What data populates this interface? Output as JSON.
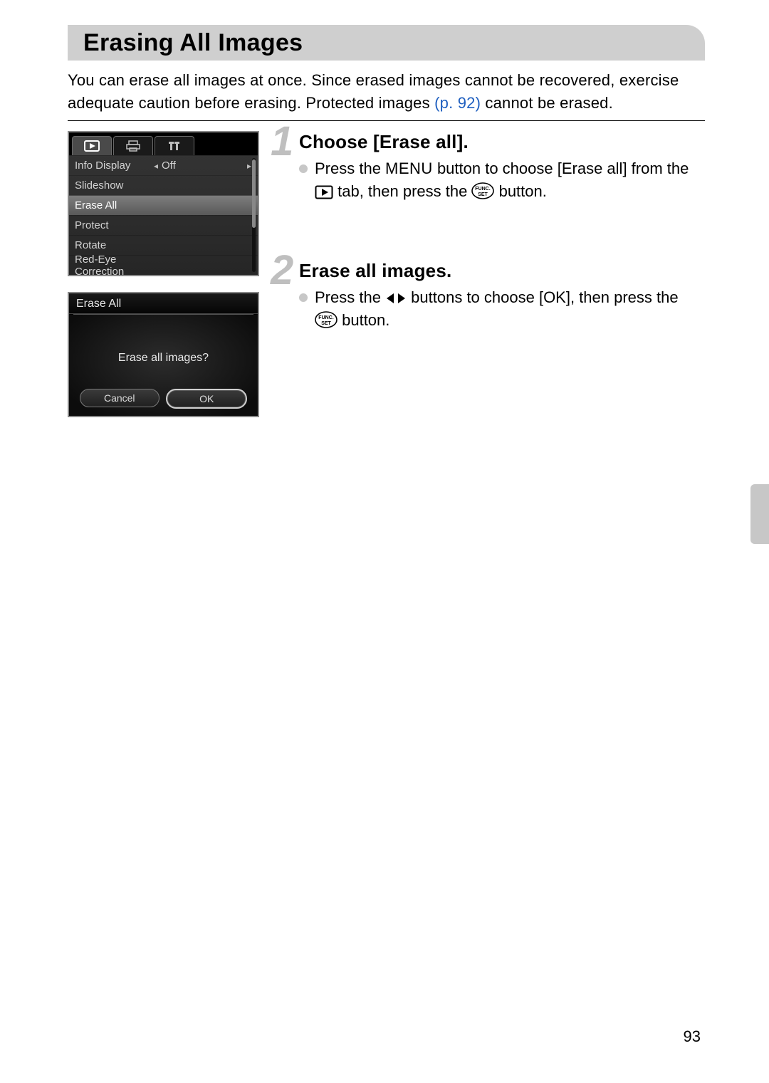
{
  "title": "Erasing All Images",
  "intro": {
    "part1": "You can erase all images at once. Since erased images cannot be recovered, exercise adequate caution before erasing. Protected images ",
    "link": "(p. 92)",
    "part2": " cannot be erased."
  },
  "menu_screen": {
    "rows": [
      {
        "label": "Info Display",
        "value": "Off",
        "has_arrows": true,
        "highlight": false
      },
      {
        "label": "Slideshow",
        "value": "",
        "has_arrows": false,
        "highlight": false
      },
      {
        "label": "Erase All",
        "value": "",
        "has_arrows": false,
        "highlight": true
      },
      {
        "label": "Protect",
        "value": "",
        "has_arrows": false,
        "highlight": false
      },
      {
        "label": "Rotate",
        "value": "",
        "has_arrows": false,
        "highlight": false
      },
      {
        "label": "Red-Eye Correction",
        "value": "",
        "has_arrows": false,
        "highlight": false
      }
    ]
  },
  "confirm_screen": {
    "header": "Erase All",
    "prompt": "Erase all images?",
    "cancel": "Cancel",
    "ok": "OK"
  },
  "steps": {
    "s1": {
      "num": "1",
      "title": "Choose [Erase all].",
      "line1a": "Press the ",
      "menu_word": "MENU",
      "line1b": " button to choose [Erase all] from the ",
      "line1c": " tab, then press the ",
      "line1d": " button."
    },
    "s2": {
      "num": "2",
      "title": "Erase all images.",
      "line1a": "Press the ",
      "line1b": " buttons to choose [OK], then press the ",
      "line1c": " button."
    }
  },
  "page_number": "93"
}
